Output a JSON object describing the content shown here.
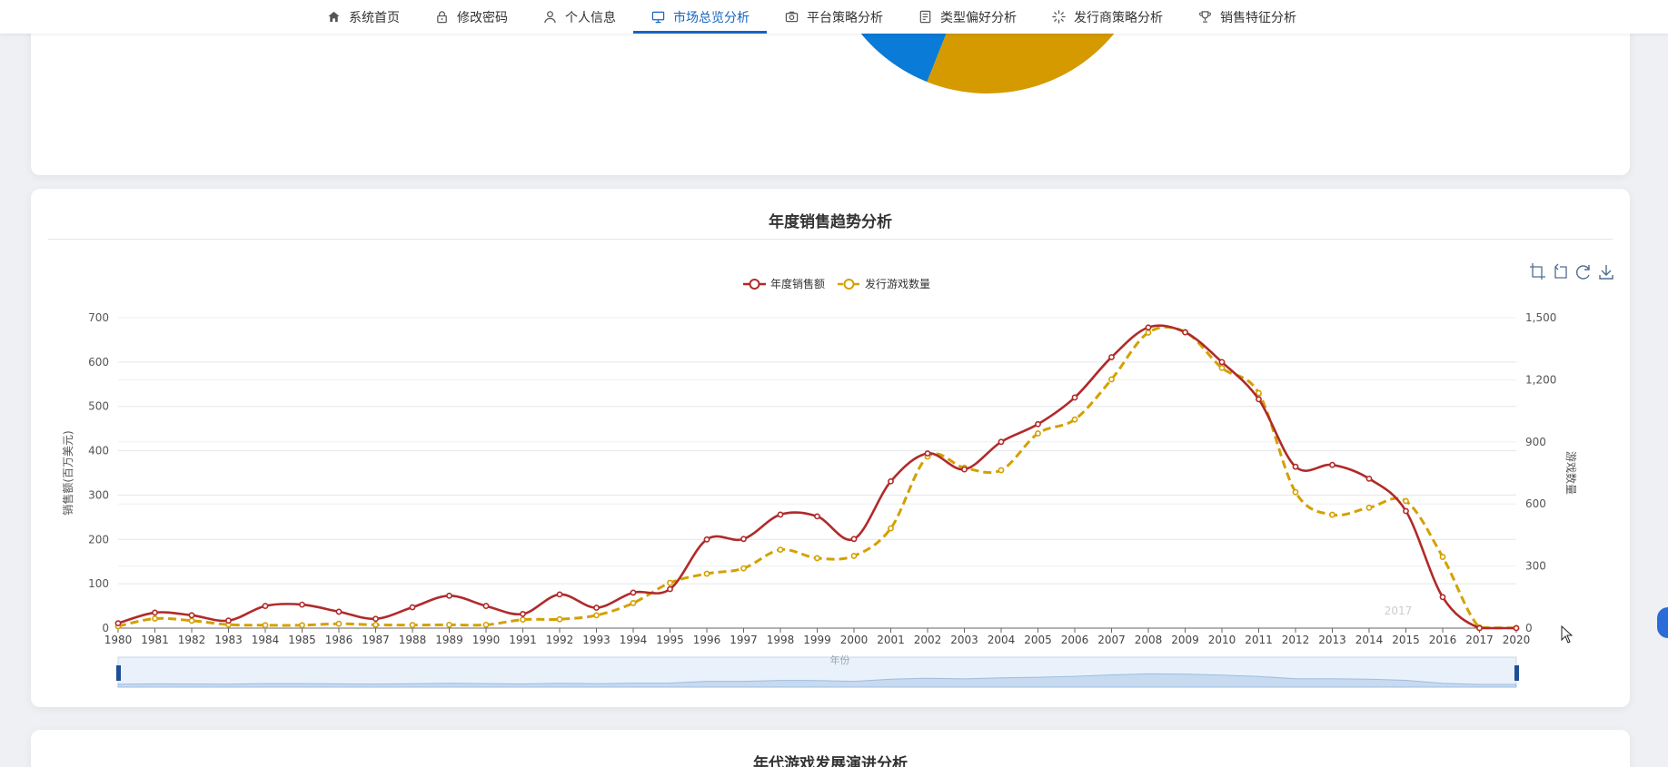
{
  "nav": {
    "items": [
      {
        "label": "系统首页",
        "icon": "home-icon",
        "active": false
      },
      {
        "label": "修改密码",
        "icon": "lock-icon",
        "active": false
      },
      {
        "label": "个人信息",
        "icon": "user-icon",
        "active": false
      },
      {
        "label": "市场总览分析",
        "icon": "monitor-icon",
        "active": true
      },
      {
        "label": "平台策略分析",
        "icon": "camera-icon",
        "active": false
      },
      {
        "label": "类型偏好分析",
        "icon": "document-icon",
        "active": false
      },
      {
        "label": "发行商策略分析",
        "icon": "spinner-icon",
        "active": false
      },
      {
        "label": "销售特征分析",
        "icon": "trophy-icon",
        "active": false
      }
    ],
    "accent": "#1565c0"
  },
  "top_card": {
    "pie_colors": [
      "#0a7bd6",
      "#d49a00"
    ]
  },
  "chart_card": {
    "title": "年度销售趋势分析",
    "toolbox_icons": [
      "zoom-select-icon",
      "zoom-reset-icon",
      "restore-icon",
      "download-icon"
    ]
  },
  "bottom_card": {
    "title": "年代游戏发展演进分析"
  },
  "chart_data": {
    "type": "line",
    "title": "年度销售趋势分析",
    "xlabel": "年份",
    "ylabel": "销售额(百万美元)",
    "y2label": "游戏数量",
    "ylim": [
      0,
      700
    ],
    "y2lim": [
      0,
      1500
    ],
    "yticks": [
      "0",
      "100",
      "200",
      "300",
      "400",
      "500",
      "600",
      "700"
    ],
    "y2ticks": [
      "0",
      "300",
      "600",
      "900",
      "1,200",
      "1,500"
    ],
    "x": [
      "1980",
      "1981",
      "1982",
      "1983",
      "1984",
      "1985",
      "1986",
      "1987",
      "1988",
      "1989",
      "1990",
      "1991",
      "1992",
      "1993",
      "1994",
      "1995",
      "1996",
      "1997",
      "1998",
      "1999",
      "2000",
      "2001",
      "2002",
      "2003",
      "2004",
      "2005",
      "2006",
      "2007",
      "2008",
      "2009",
      "2010",
      "2011",
      "2012",
      "2013",
      "2014",
      "2015",
      "2016",
      "2017",
      "2020"
    ],
    "grid": true,
    "legend_position": "top",
    "series": [
      {
        "name": "年度销售额",
        "axis": "left",
        "color": "#b02a2a",
        "style": "solid",
        "values": [
          11,
          35,
          29,
          17,
          50,
          53,
          37,
          21,
          47,
          73,
          50,
          32,
          76,
          46,
          80,
          88,
          200,
          201,
          256,
          252,
          201,
          331,
          394,
          358,
          420,
          460,
          520,
          611,
          678,
          667,
          600,
          516,
          364,
          368,
          337,
          264,
          70,
          0,
          0
        ]
      },
      {
        "name": "发行游戏数量",
        "axis": "right",
        "color": "#d4a000",
        "style": "dashed",
        "values": [
          9,
          46,
          36,
          17,
          14,
          14,
          21,
          16,
          15,
          16,
          16,
          41,
          43,
          62,
          121,
          219,
          263,
          289,
          379,
          338,
          349,
          482,
          829,
          775,
          763,
          941,
          1008,
          1202,
          1428,
          1431,
          1257,
          1136,
          657,
          548,
          582,
          614,
          344,
          3,
          1
        ]
      }
    ],
    "datazoom": {
      "start": "1980",
      "end": "2020",
      "label_hover": "2017"
    }
  }
}
